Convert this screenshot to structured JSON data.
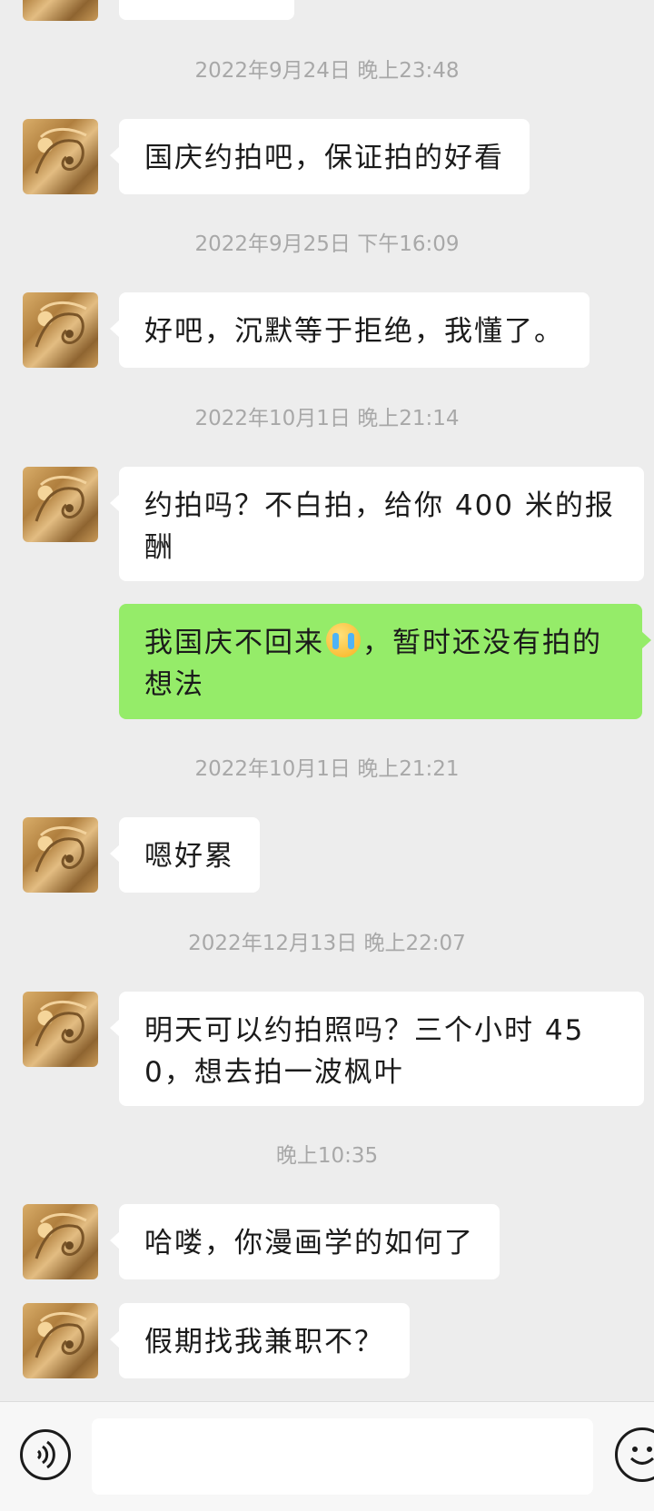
{
  "messages": [
    {
      "timestamp": "2022年9月24日 晚上23:48",
      "text": "国庆约拍吧，保证拍的好看",
      "from": "them"
    },
    {
      "timestamp": "2022年9月25日 下午16:09",
      "text": "好吧，沉默等于拒绝，我懂了。",
      "from": "them"
    },
    {
      "timestamp": "2022年10月1日 晚上21:14",
      "text": "约拍吗？不白拍，给你 400 米的报酬",
      "from": "them"
    },
    {
      "text_before_emoji": "我国庆不回来",
      "emoji": "loudly-crying-face",
      "text_after_emoji": "，暂时还没有拍的想法",
      "from": "me"
    },
    {
      "timestamp": "2022年10月1日 晚上21:21",
      "text": "嗯好累",
      "from": "them"
    },
    {
      "timestamp": "2022年12月13日 晚上22:07",
      "text": "明天可以约拍照吗？三个小时 450，想去拍一波枫叶",
      "from": "them"
    },
    {
      "timestamp": "晚上10:35",
      "text": "哈喽，你漫画学的如何了",
      "from": "them"
    },
    {
      "text": "假期找我兼职不？",
      "from": "them"
    }
  ],
  "input_bar": {
    "input_value": "",
    "voice_icon": "voice-icon",
    "emoji_icon": "emoji-icon"
  },
  "colors": {
    "background": "#ededed",
    "incoming_bubble": "#ffffff",
    "outgoing_bubble": "#95ec69",
    "timestamp_text": "#a8a8a8"
  }
}
